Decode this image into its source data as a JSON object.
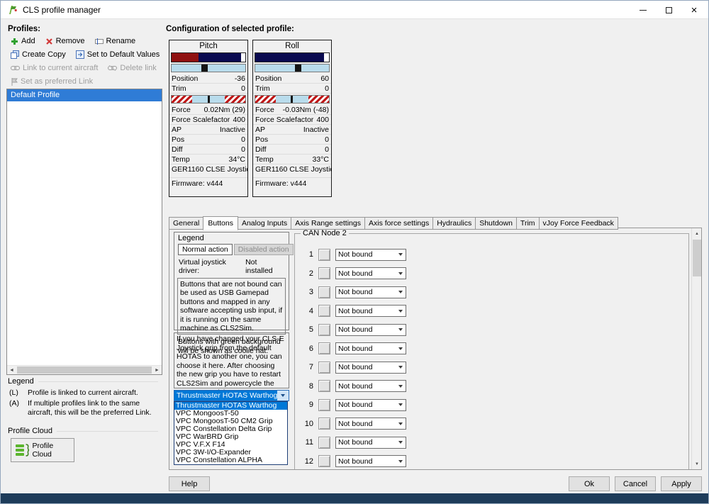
{
  "window": {
    "title": "CLS profile manager",
    "icons": {
      "close": "×",
      "scroll_up": "▲",
      "scroll_down": "▼",
      "scroll_left": "◄",
      "scroll_right": "►"
    }
  },
  "colors": {
    "selection_blue": "#2f7cd6",
    "highlight_blue": "#0078d7",
    "gauge_red": "#8f1010",
    "gauge_navy": "#0a0a50",
    "gauge_lightblue": "#b9dcec",
    "bottom_strip": "#1e3c5a"
  },
  "profiles_panel": {
    "title": "Profiles:",
    "toolbar": {
      "add": "Add",
      "remove": "Remove",
      "rename": "Rename",
      "create_copy": "Create Copy",
      "set_default": "Set to Default Values",
      "link_aircraft": "Link to current aircraft",
      "delete_link": "Delete link",
      "set_preferred": "Set as preferred Link"
    },
    "profiles": [
      "Default Profile"
    ],
    "legend": {
      "title": "Legend",
      "l_key": "(L)",
      "l_text": "Profile is linked to current aircraft.",
      "a_key": "(A)",
      "a_text": "If multiple profiles link to the same aircraft, this will be the preferred Link."
    },
    "cloud": {
      "title": "Profile Cloud",
      "button": "Profile Cloud"
    }
  },
  "config": {
    "title": "Configuration of selected profile:",
    "axes": [
      {
        "name": "Pitch",
        "position_label": "Position",
        "position_value": "-36",
        "trim_label": "Trim",
        "trim_value": "0",
        "force_label": "Force",
        "force_value": "0.02Nm (29)",
        "scalefactor_label": "Force Scalefactor",
        "scalefactor_value": "400",
        "ap_label": "AP",
        "ap_value": "Inactive",
        "pos_label": "Pos",
        "pos_value": "0",
        "diff_label": "Diff",
        "diff_value": "0",
        "temp_label": "Temp",
        "temp_value": "34°C",
        "device": "GER1160 CLSE Joystic...",
        "firmware": "Firmware: v444"
      },
      {
        "name": "Roll",
        "position_label": "Position",
        "position_value": "60",
        "trim_label": "Trim",
        "trim_value": "0",
        "force_label": "Force",
        "force_value": "-0.03Nm (-48)",
        "scalefactor_label": "Force Scalefactor",
        "scalefactor_value": "400",
        "ap_label": "AP",
        "ap_value": "Inactive",
        "pos_label": "Pos",
        "pos_value": "0",
        "diff_label": "Diff",
        "diff_value": "0",
        "temp_label": "Temp",
        "temp_value": "33°C",
        "device": "GER1160 CLSE Joystic...",
        "firmware": "Firmware: v444"
      }
    ],
    "tabs": [
      "General",
      "Buttons",
      "Analog Inputs",
      "Axis Range settings",
      "Axis force settings",
      "Hydraulics",
      "Shutdown",
      "Trim",
      "vJoy Force Feedback"
    ],
    "active_tab": "Buttons"
  },
  "buttons_tab": {
    "legend": {
      "title": "Legend",
      "normal_btn": "Normal action",
      "disabled_btn": "Disabled action",
      "driver_label": "Virtual joystick driver:",
      "driver_value": "Not installed",
      "info": "Buttons that are not bound can be used as USB Gamepad buttons and mapped in any software accepting usb input, if it is running on the same machine as CLS2Sim.",
      "coolie_note": "Buttons with green background will be shown as coolie hat."
    },
    "grip": {
      "info": "If you have changed your CLS-E Joystick grip from the default HOTAS to another one, you can choose it here. After choosing the new grip you have to restart CLS2Sim and powercycle the CLS-E Joystick.",
      "selected": "Thrustmaster HOTAS Warthog",
      "options": [
        "Thrustmaster HOTAS Warthog",
        "VPC MongoosT-50",
        "VPC MongoosT-50 CM2 Grip",
        "VPC Constellation Delta Grip",
        "VPC WarBRD Grip",
        "VPC V.F.X F14",
        "VPC 3W-I/O-Expander",
        "VPC Constellation ALPHA"
      ]
    },
    "can_node": {
      "title": "CAN Node 2",
      "rows": [
        {
          "num": "1",
          "binding": "Not bound"
        },
        {
          "num": "2",
          "binding": "Not bound"
        },
        {
          "num": "3",
          "binding": "Not bound"
        },
        {
          "num": "4",
          "binding": "Not bound"
        },
        {
          "num": "5",
          "binding": "Not bound"
        },
        {
          "num": "6",
          "binding": "Not bound"
        },
        {
          "num": "7",
          "binding": "Not bound"
        },
        {
          "num": "8",
          "binding": "Not bound"
        },
        {
          "num": "9",
          "binding": "Not bound"
        },
        {
          "num": "10",
          "binding": "Not bound"
        },
        {
          "num": "11",
          "binding": "Not bound"
        },
        {
          "num": "12",
          "binding": "Not bound"
        }
      ]
    }
  },
  "footer": {
    "help": "Help",
    "ok": "Ok",
    "cancel": "Cancel",
    "apply": "Apply"
  }
}
